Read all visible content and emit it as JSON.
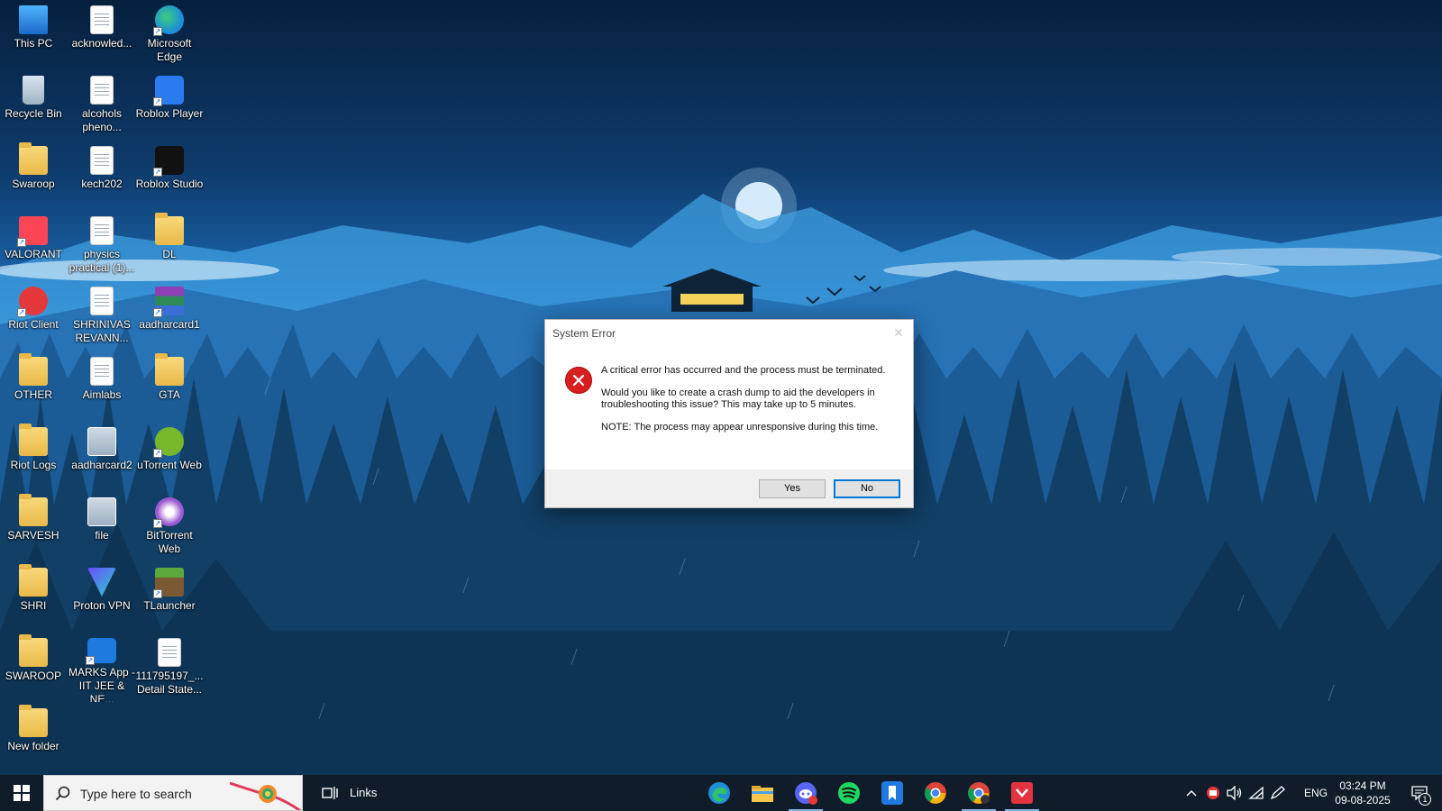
{
  "desktop": {
    "icons": [
      {
        "label": "This PC",
        "icon": "this-pc-icon"
      },
      {
        "label": "acknowled...",
        "icon": "document-icon"
      },
      {
        "label": "Microsoft Edge",
        "icon": "edge-icon"
      },
      {
        "label": "Recycle Bin",
        "icon": "recycle-bin-icon"
      },
      {
        "label": "alcohols pheno...",
        "icon": "document-icon"
      },
      {
        "label": "Roblox Player",
        "icon": "roblox-player-icon"
      },
      {
        "label": "Swaroop",
        "icon": "user-folder-icon"
      },
      {
        "label": "kech202",
        "icon": "document-icon"
      },
      {
        "label": "Roblox Studio",
        "icon": "roblox-studio-icon"
      },
      {
        "label": "VALORANT",
        "icon": "valorant-icon"
      },
      {
        "label": "physics practical (1)...",
        "icon": "document-icon"
      },
      {
        "label": "DL",
        "icon": "folder-icon"
      },
      {
        "label": "Riot Client",
        "icon": "riot-client-icon"
      },
      {
        "label": "SHRINIVAS REVANN...",
        "icon": "document-icon"
      },
      {
        "label": "aadharcard1",
        "icon": "winrar-icon"
      },
      {
        "label": "OTHER",
        "icon": "folder-icon"
      },
      {
        "label": "Aimlabs",
        "icon": "document-icon"
      },
      {
        "label": "GTA",
        "icon": "folder-icon"
      },
      {
        "label": "Riot Logs",
        "icon": "folder-icon"
      },
      {
        "label": "aadharcard2",
        "icon": "image-icon"
      },
      {
        "label": "uTorrent Web",
        "icon": "utorrent-icon"
      },
      {
        "label": "SARVESH",
        "icon": "folder-icon"
      },
      {
        "label": "file",
        "icon": "image-icon"
      },
      {
        "label": "BitTorrent Web",
        "icon": "bittorrent-icon"
      },
      {
        "label": "SHRI",
        "icon": "folder-icon"
      },
      {
        "label": "Proton VPN",
        "icon": "proton-vpn-icon"
      },
      {
        "label": "TLauncher",
        "icon": "tlauncher-icon"
      },
      {
        "label": "SWAROOP",
        "icon": "folder-icon"
      },
      {
        "label": "MARKS App - IIT JEE & NE...",
        "icon": "marks-app-icon"
      },
      {
        "label": "111795197_... Detail State...",
        "icon": "document-icon"
      },
      {
        "label": "New folder",
        "icon": "folder-icon"
      }
    ]
  },
  "dialog": {
    "title": "System Error",
    "close_glyph": "✕",
    "message_line1": "A critical error has occurred and the process must be terminated.",
    "message_line2": "Would you like to create a crash dump to aid the developers in troubleshooting this issue? This may take up to 5 minutes.",
    "message_line3": "NOTE: The process may appear unresponsive during this time.",
    "yes_label": "Yes",
    "no_label": "No"
  },
  "taskbar": {
    "search_placeholder": "Type here to search",
    "links_label": "Links",
    "pinned_apps": [
      "edge-icon",
      "file-explorer-icon",
      "discord-icon",
      "spotify-icon",
      "marks-app-icon",
      "chrome-icon",
      "chrome-profile-icon",
      "pdf-app-icon"
    ],
    "language": "ENG",
    "time": "03:24 PM",
    "date": "09-08-2025",
    "notification_count": "1"
  },
  "colors": {
    "accent": "#0078d7",
    "error_red": "#d81e1e",
    "taskbar_bg": "#101c2a"
  }
}
